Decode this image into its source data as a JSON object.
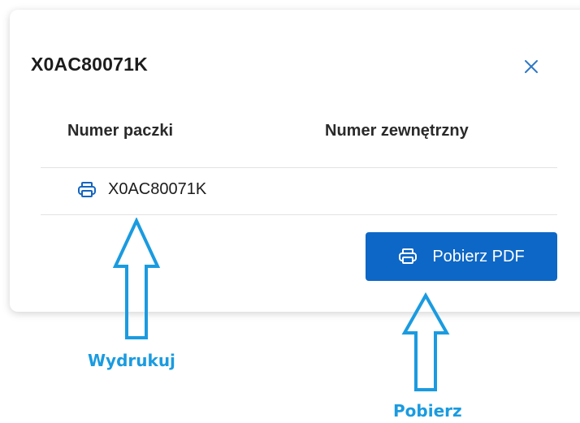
{
  "dialog": {
    "title": "X0AC80071K",
    "close_icon": "close-icon"
  },
  "table": {
    "columns": [
      "Numer paczki",
      "Numer zewnętrzny"
    ],
    "rows": [
      {
        "package_number": "X0AC80071K",
        "external_number": "",
        "icon": "printer-icon"
      }
    ]
  },
  "actions": {
    "download_pdf_label": "Pobierz PDF",
    "download_pdf_icon": "printer-icon"
  },
  "annotations": {
    "print_label": "Wydrukuj",
    "download_label": "Pobierz",
    "color": "#1a9be0"
  },
  "colors": {
    "accent": "#0d67c6",
    "icon_blue": "#1565c0"
  }
}
